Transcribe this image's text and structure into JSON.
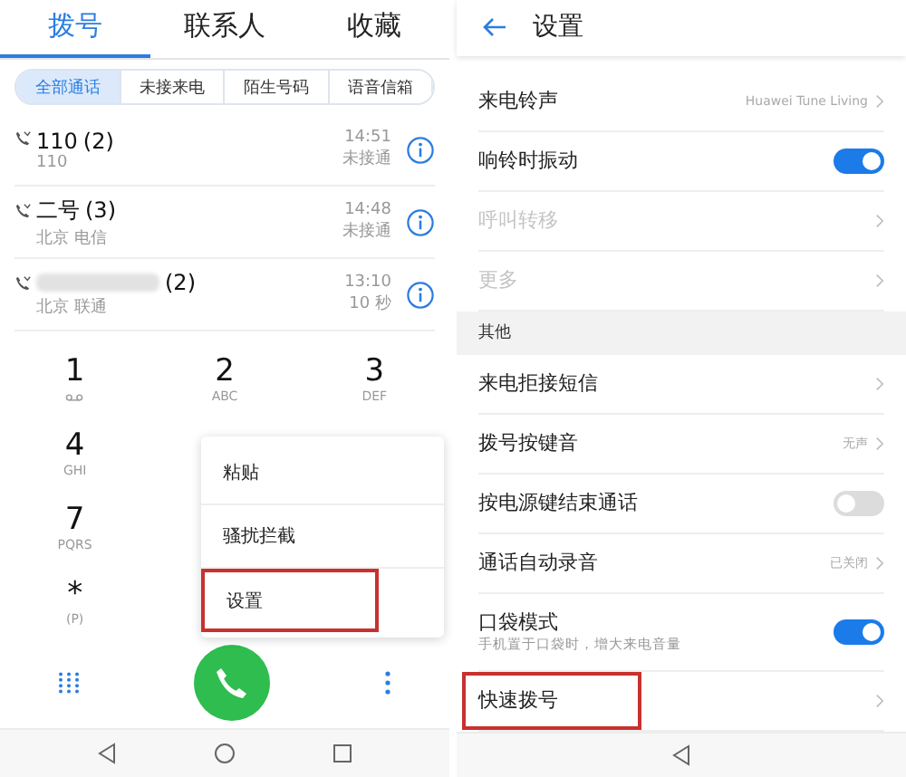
{
  "dialer": {
    "tabs": [
      {
        "label": "拨号",
        "selected": true
      },
      {
        "label": "联系人",
        "selected": false
      },
      {
        "label": "收藏",
        "selected": false
      }
    ],
    "filters": [
      {
        "label": "全部通话",
        "selected": true
      },
      {
        "label": "未接来电",
        "selected": false
      },
      {
        "label": "陌生号码",
        "selected": false
      },
      {
        "label": "语音信箱",
        "selected": false
      }
    ],
    "calls": [
      {
        "name": "110",
        "count": "(2)",
        "blurred": false,
        "detail": "110",
        "time": "14:51",
        "status": "未接通"
      },
      {
        "name": "二号",
        "count": "(3)",
        "blurred": false,
        "detail": "北京 电信",
        "time": "14:48",
        "status": "未接通"
      },
      {
        "count": "(2)",
        "blurred": true,
        "detail": "北京 联通",
        "time": "13:10",
        "status": "10 秒"
      }
    ],
    "keypad": [
      [
        {
          "digit": "1"
        },
        {
          "digit": "2",
          "letters": "ABC"
        },
        {
          "digit": "3",
          "letters": "DEF"
        }
      ],
      [
        {
          "digit": "4",
          "letters": "GHI"
        }
      ],
      [
        {
          "digit": "7",
          "letters": "PQRS"
        }
      ],
      [
        {
          "digit": "*",
          "letters": "(P)"
        }
      ]
    ],
    "menu": [
      {
        "label": "粘贴",
        "highlighted": false
      },
      {
        "label": "骚扰拦截",
        "highlighted": false
      },
      {
        "label": "设置",
        "highlighted": true
      }
    ]
  },
  "settings": {
    "title": "设置",
    "items": [
      {
        "kind": "link",
        "label": "来电铃声",
        "value": "Huawei Tune Living",
        "disabled": false,
        "highlighted": false
      },
      {
        "kind": "toggle",
        "label": "响铃时振动",
        "on": true
      },
      {
        "kind": "link",
        "label": "呼叫转移",
        "disabled": true,
        "highlighted": false
      },
      {
        "kind": "link",
        "label": "更多",
        "disabled": true,
        "highlighted": false
      },
      {
        "kind": "section",
        "label": "其他"
      },
      {
        "kind": "link",
        "label": "来电拒接短信",
        "disabled": false,
        "highlighted": false
      },
      {
        "kind": "link",
        "label": "拨号按键音",
        "value": "无声",
        "disabled": false,
        "highlighted": false
      },
      {
        "kind": "toggle",
        "label": "按电源键结束通话",
        "on": false
      },
      {
        "kind": "link",
        "label": "通话自动录音",
        "value": "已关闭",
        "disabled": false,
        "highlighted": false
      },
      {
        "kind": "toggle",
        "label": "口袋模式",
        "subtitle": "手机置于口袋时，增大来电音量",
        "on": true
      },
      {
        "kind": "link",
        "label": "快速拨号",
        "disabled": false,
        "highlighted": true
      }
    ]
  }
}
